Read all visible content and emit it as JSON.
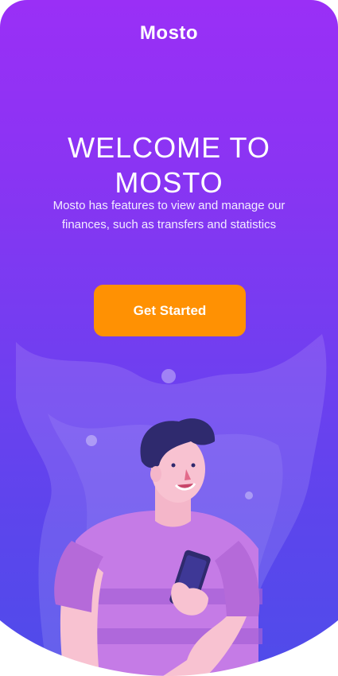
{
  "app": {
    "logo": "Mosto"
  },
  "hero": {
    "title_line1": "WELCOME TO",
    "title_line2": "MOSTO",
    "subtitle_line1": "Mosto has features to view and manage our",
    "subtitle_line2": "finances, such as transfers and statistics"
  },
  "cta": {
    "label": "Get Started"
  },
  "colors": {
    "gradient_top": "#9a2ff6",
    "gradient_bottom": "#4f4cea",
    "cta": "#ff9103",
    "text": "#ffffff"
  },
  "illustration": {
    "subject": "man-looking-at-phone"
  }
}
